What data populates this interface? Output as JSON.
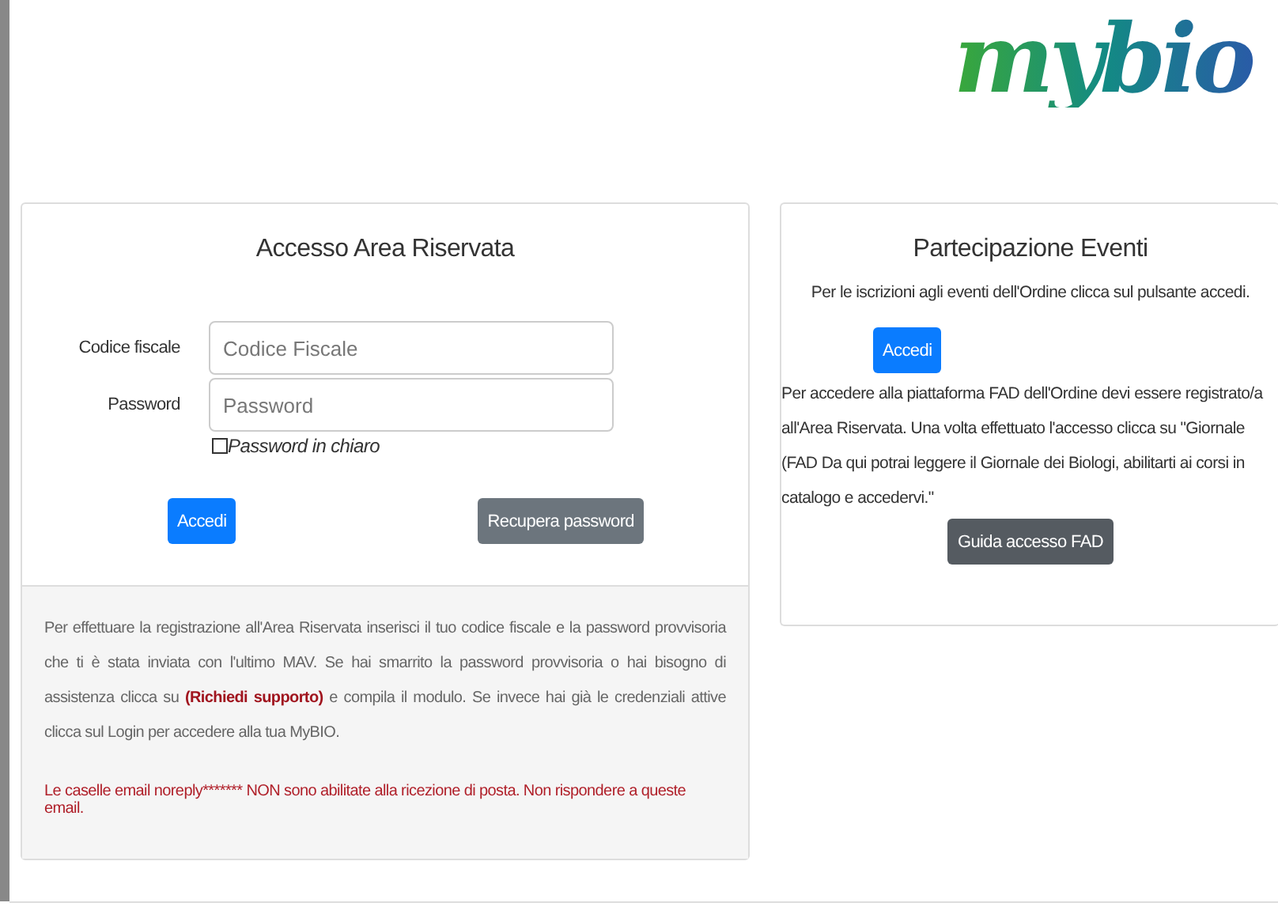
{
  "logo": "mybio",
  "login": {
    "title": "Accesso Area Riservata",
    "fields": [
      {
        "label": "Codice fiscale",
        "placeholder": "Codice Fiscale"
      },
      {
        "label": "Password",
        "placeholder": "Password"
      }
    ],
    "show_password": {
      "label": "Password in chiaro",
      "checked": false
    },
    "buttons": [
      {
        "label": "Accedi",
        "kind": "primary"
      },
      {
        "label": "Recupera password",
        "kind": "secondary"
      }
    ],
    "info": {
      "before": "Per effettuare la registrazione all'Area Riservata inserisci il tuo codice fiscale e la password provvisoria che ti è stata inviata con l'ultimo MAV. Se hai smarrito la password provvisoria o hai bisogno di assistenza clicca su ",
      "link": "(Richiedi supporto)",
      "after": " e compila il modulo. Se invece hai già le credenziali attive clicca sul Login per accedere alla tua MyBIO."
    },
    "warning": "Le caselle email noreply******* NON sono abilitate alla ricezione di posta. Non rispondere a queste email."
  },
  "events": {
    "title": "Partecipazione Eventi",
    "intro": "Per le iscrizioni agli eventi dell'Ordine clicca sul pulsante accedi.",
    "button": {
      "label": "Accedi",
      "kind": "primary"
    },
    "fad_text": "Per accedere alla piattaforma FAD dell'Ordine devi essere registrato/a all'Area Riservata. Una volta effettuato l'accesso clicca su \"Giornale (FAD Da qui potrai leggere il Giornale dei Biologi, abilitarti ai corsi in catalogo e accedervi.\"",
    "fad_button": {
      "label": "Guida accesso FAD",
      "kind": "dark"
    }
  }
}
